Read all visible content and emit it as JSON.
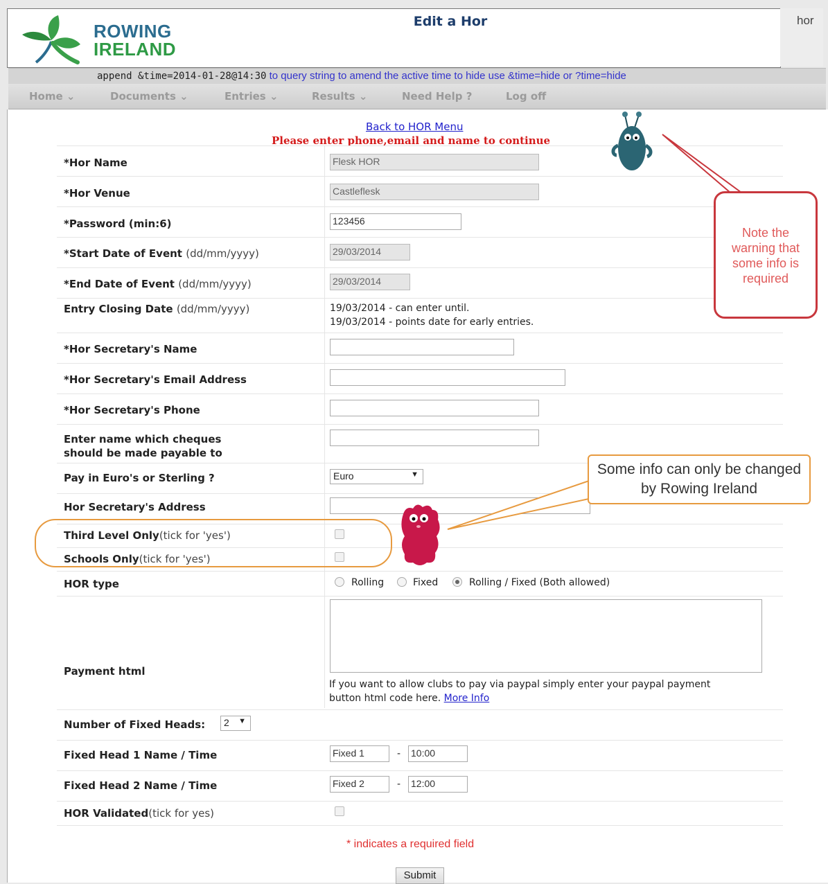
{
  "header": {
    "logo_line1": "ROWING",
    "logo_line2": "IRELAND",
    "title": "Edit a Hor",
    "user": "hor",
    "time_hint_code": "append &time=2014-01-28@14:30",
    "time_hint_text": "to query string to amend the active time to hide use &time=hide or ?time=hide"
  },
  "nav": [
    {
      "label": "Home"
    },
    {
      "label": "Documents"
    },
    {
      "label": "Entries"
    },
    {
      "label": "Results"
    },
    {
      "label": "Need Help ?"
    },
    {
      "label": "Log off"
    }
  ],
  "back_link": "Back to HOR Menu",
  "warning": "Please enter phone,email and name to continue",
  "form": {
    "hor_name": {
      "label": "*Hor Name",
      "value": "Flesk HOR"
    },
    "hor_venue": {
      "label": "*Hor Venue",
      "value": "Castleflesk"
    },
    "password": {
      "label": "*Password (min:6)",
      "value": "123456"
    },
    "start_date": {
      "label": "*Start Date of Event",
      "hint": "(dd/mm/yyyy)",
      "value": "29/03/2014"
    },
    "end_date": {
      "label": "*End Date of Event",
      "hint": "(dd/mm/yyyy)",
      "value": "29/03/2014"
    },
    "closing_date": {
      "label": "Entry Closing Date",
      "hint": "(dd/mm/yyyy)",
      "line1": "19/03/2014 - can enter until.",
      "line2": "19/03/2014 - points date for early entries."
    },
    "sec_name": {
      "label": "*Hor Secretary's Name",
      "value": ""
    },
    "sec_email": {
      "label": "*Hor Secretary's Email Address",
      "value": ""
    },
    "sec_phone": {
      "label": "*Hor Secretary's Phone",
      "value": ""
    },
    "cheque_name": {
      "label_line1": "Enter name which cheques",
      "label_line2": "should be made payable to",
      "value": ""
    },
    "currency": {
      "label": "Pay in Euro's or Sterling ?",
      "value": "Euro"
    },
    "sec_address": {
      "label": "Hor Secretary's Address",
      "value": ""
    },
    "third_level": {
      "label": "Third Level Only",
      "hint": "(tick for 'yes')",
      "checked": false
    },
    "schools_only": {
      "label": "Schools Only",
      "hint": "(tick for 'yes')",
      "checked": false
    },
    "hor_type": {
      "label": "HOR type",
      "options": [
        "Rolling",
        "Fixed",
        "Rolling / Fixed (Both allowed)"
      ],
      "selected": "Rolling / Fixed (Both allowed)"
    },
    "payment_html": {
      "label": "Payment html",
      "value": "",
      "help_line1": "If you want to allow clubs to pay via paypal simply enter your paypal payment",
      "help_line2": "button html code here.",
      "more_info": "More Info"
    },
    "fixed_heads": {
      "label": "Number of Fixed Heads:",
      "value": "2"
    },
    "fixed_head_1": {
      "label": "Fixed Head 1 Name / Time",
      "name": "Fixed 1",
      "time": "10:00"
    },
    "fixed_head_2": {
      "label": "Fixed Head 2 Name / Time",
      "name": "Fixed 2",
      "time": "12:00"
    },
    "validated": {
      "label": "HOR Validated",
      "hint": "(tick for yes)",
      "checked": false
    },
    "dash": "-"
  },
  "required_note": "* indicates a required field",
  "submit_label": "Submit",
  "annotations": {
    "callout_required": "Note the warning that some info is required",
    "callout_locked": "Some info can only be changed by Rowing Ireland"
  },
  "colors": {
    "warning": "#d41b1b",
    "link": "#2222cc",
    "callout_red": "#c8373d",
    "callout_orange": "#e79a3f"
  }
}
